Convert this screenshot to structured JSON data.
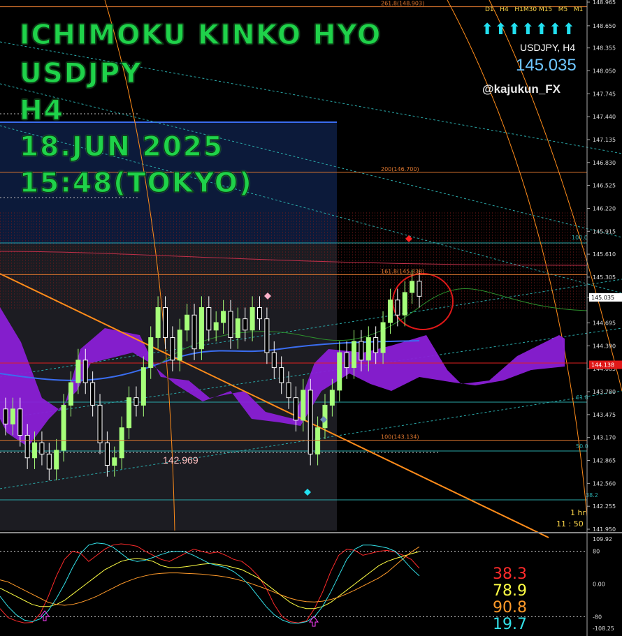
{
  "overlay_title": {
    "line1": "ICHIMOKU KINKO HYO",
    "line2": "USDJPY",
    "line3": "H4",
    "line4": "18.JUN 2025",
    "line5": "15:48(TOKYO)"
  },
  "panel": {
    "timeframes": [
      "D1",
      "H4",
      "H1",
      "M30",
      "M15",
      "M5",
      "M1"
    ],
    "symbol_tf": "USDJPY, H4",
    "price": "145.035",
    "author": "@kajukun_FX",
    "timer_label": "1 hr",
    "timer_value": "11 : 50",
    "low_label": "142.969"
  },
  "colors": {
    "bull": "#a6ff7a",
    "bear": "#ffffff",
    "kumo": "#8a1fd6",
    "kijun": "#3a6df0",
    "trend": "#ff8c1a",
    "fib": "#e0782f",
    "price": "#6ec6ff"
  },
  "chart_data": [
    {
      "type": "candlestick",
      "symbol": "USDJPY",
      "timeframe": "H4",
      "ylim": [
        141.95,
        148.965
      ],
      "y_ticks": [
        "148.965",
        "148.650",
        "148.355",
        "148.050",
        "147.745",
        "147.440",
        "147.135",
        "146.830",
        "146.525",
        "146.220",
        "145.915",
        "145.610",
        "145.305",
        "145.035",
        "144.695",
        "144.390",
        "144.085",
        "143.780",
        "143.475",
        "143.170",
        "142.865",
        "142.560",
        "142.255",
        "141.950"
      ],
      "current_price": 145.035,
      "marked_level": "144.138",
      "fib_levels": [
        {
          "label": "261.8(148.903)",
          "value": 148.903
        },
        {
          "label": "200(146.700)",
          "value": 146.7
        },
        {
          "label": "161.8(145.338)",
          "value": 145.338
        },
        {
          "label": "100(143.134)",
          "value": 143.134
        }
      ],
      "fan_labels": [
        "100.0",
        "61.8",
        "50.0",
        "38.2"
      ],
      "close_prices": [
        143.35,
        143.55,
        143.2,
        142.9,
        143.1,
        142.95,
        142.75,
        143.0,
        143.6,
        143.9,
        144.2,
        143.9,
        143.6,
        143.1,
        142.8,
        142.9,
        143.3,
        143.7,
        143.6,
        144.1,
        144.5,
        144.9,
        144.5,
        144.2,
        144.6,
        144.8,
        144.35,
        144.9,
        144.6,
        144.7,
        144.85,
        144.5,
        144.75,
        144.6,
        144.9,
        144.75,
        144.3,
        144.1,
        143.9,
        143.7,
        143.4,
        143.8,
        142.95,
        143.3,
        143.6,
        143.8,
        144.3,
        144.1,
        144.45,
        144.2,
        144.5,
        144.3,
        144.7,
        145.0,
        144.8,
        145.1,
        145.25,
        145.05
      ]
    },
    {
      "type": "line",
      "name_values": [
        "38.3",
        "78.9",
        "90.8",
        "19.7"
      ],
      "ylim": [
        -108.25,
        109.92
      ],
      "y_ticks": [
        "109.92",
        "80",
        "0.00",
        "-80",
        "-108.25"
      ],
      "series": [
        {
          "color": "#ff2b2b",
          "values": [
            -60,
            -82,
            -90,
            -95,
            -94,
            -72,
            -30,
            20,
            60,
            80,
            75,
            55,
            70,
            85,
            95,
            98,
            96,
            92,
            80,
            70,
            60,
            55,
            65,
            75,
            85,
            80,
            75,
            78,
            70,
            60,
            55,
            40,
            20,
            -10,
            -50,
            -80,
            -92,
            -95,
            -90,
            -60,
            -20,
            30,
            70,
            85,
            82,
            70,
            75,
            80,
            82,
            78,
            70,
            60,
            38.3
          ]
        },
        {
          "color": "#ffff44",
          "values": [
            -10,
            -20,
            -30,
            -40,
            -50,
            -55,
            -55,
            -50,
            -40,
            -25,
            -10,
            5,
            20,
            35,
            45,
            55,
            60,
            62,
            60,
            55,
            45,
            40,
            40,
            42,
            45,
            48,
            50,
            48,
            45,
            40,
            35,
            25,
            15,
            0,
            -15,
            -30,
            -45,
            -55,
            -60,
            -60,
            -55,
            -45,
            -30,
            -15,
            0,
            15,
            30,
            45,
            55,
            62,
            68,
            74,
            78.9
          ]
        },
        {
          "color": "#ff9a2a",
          "values": [
            10,
            5,
            -5,
            -15,
            -25,
            -35,
            -45,
            -50,
            -52,
            -50,
            -45,
            -38,
            -30,
            -20,
            -10,
            0,
            8,
            15,
            20,
            24,
            26,
            27,
            27,
            26,
            25,
            24,
            22,
            20,
            17,
            13,
            8,
            2,
            -5,
            -12,
            -20,
            -28,
            -35,
            -40,
            -43,
            -44,
            -42,
            -38,
            -32,
            -24,
            -15,
            -5,
            5,
            15,
            28,
            45,
            62,
            78,
            90.8
          ]
        },
        {
          "color": "#33e0e8",
          "values": [
            -30,
            -55,
            -75,
            -88,
            -92,
            -85,
            -65,
            -35,
            0,
            40,
            75,
            95,
            100,
            98,
            90,
            75,
            60,
            55,
            58,
            65,
            72,
            78,
            80,
            78,
            70,
            60,
            50,
            45,
            40,
            30,
            15,
            -5,
            -30,
            -55,
            -75,
            -88,
            -95,
            -96,
            -92,
            -80,
            -55,
            -20,
            20,
            60,
            85,
            95,
            95,
            92,
            88,
            80,
            60,
            38,
            19.7
          ]
        }
      ]
    }
  ]
}
